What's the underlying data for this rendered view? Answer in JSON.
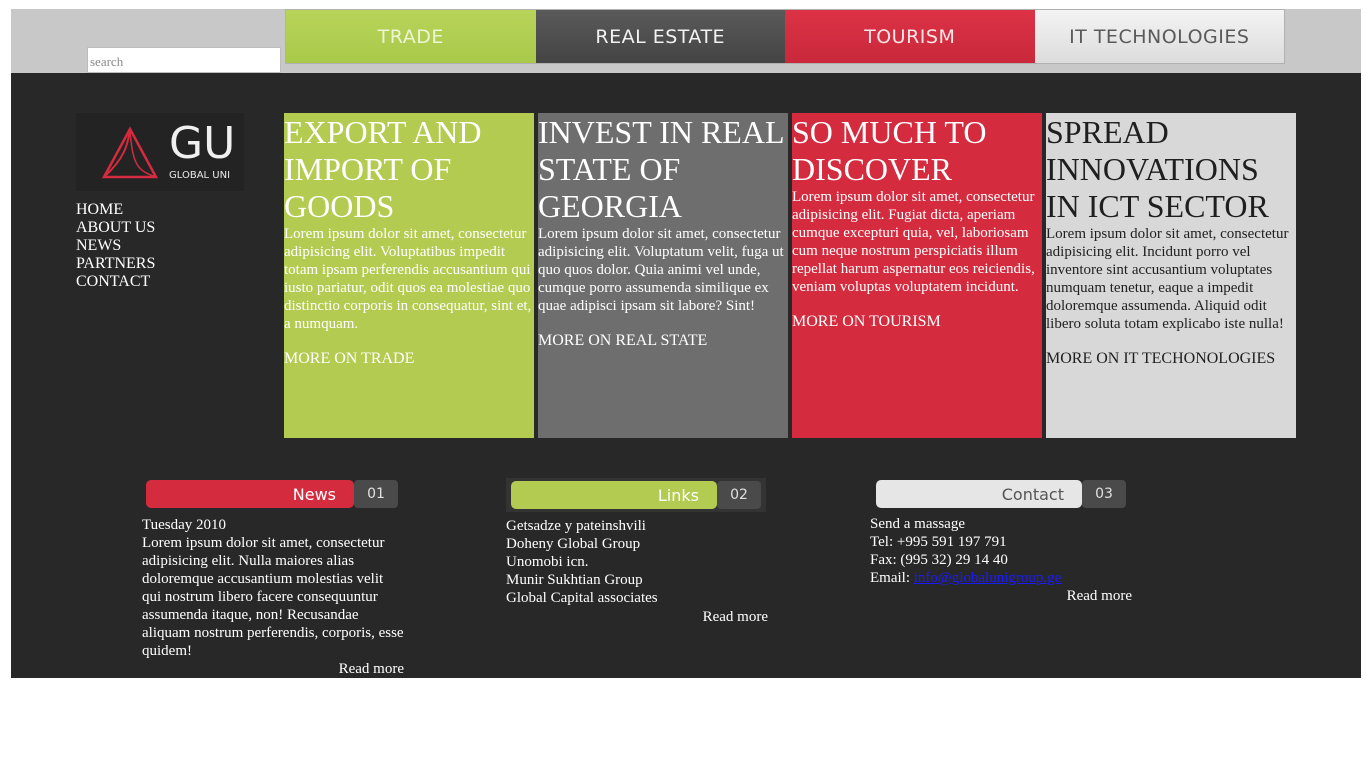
{
  "header": {
    "search_placeholder": "search",
    "tabs": [
      {
        "label": "TRADE",
        "color": "#b2cb50"
      },
      {
        "label": "REAL ESTATE",
        "color": "#4f4f4f"
      },
      {
        "label": "TOURISM",
        "color": "#d42b3e"
      },
      {
        "label": "IT TECHNOLOGIES",
        "color": "#e6e6e6"
      }
    ]
  },
  "logo": {
    "mark": "GU",
    "caption": "GLOBAL UNI",
    "icon": "triangle-logo-icon"
  },
  "nav": [
    "HOME",
    "ABOUT US",
    "NEWS",
    "PARTNERS",
    "CONTACT"
  ],
  "panels": [
    {
      "title": "EXPORT AND IMPORT OF GOODS",
      "body": "Lorem ipsum dolor sit amet, consectetur adipisicing elit. Voluptatibus impedit totam ipsam perferendis accusantium qui iusto pariatur, odit quos ea molestiae quo distinctio corporis in consequatur, sint et, a numquam.",
      "more": "MORE ON TRADE",
      "color": "#b2cb50"
    },
    {
      "title": "INVEST IN REAL STATE OF GEORGIA",
      "body": "Lorem ipsum dolor sit amet, consectetur adipisicing elit. Voluptatum velit, fuga ut quo quos dolor. Quia animi vel unde, cumque porro assumenda similique ex quae adipisci ipsam sit labore? Sint!",
      "more": "MORE ON REAL STATE",
      "color": "#6e6e6e"
    },
    {
      "title": "SO MUCH TO DISCOVER",
      "body": "Lorem ipsum dolor sit amet, consectetur adipisicing elit. Fugiat dicta, aperiam cumque excepturi quia, vel, laboriosam cum neque nostrum perspiciatis illum repellat harum aspernatur eos reiciendis, veniam voluptas voluptatem incidunt.",
      "more": "MORE ON TOURISM",
      "color": "#d42b3e"
    },
    {
      "title": "SPREAD INNOVATIONS IN ICT SECTOR",
      "body": "Lorem ipsum dolor sit amet, consectetur adipisicing elit. Incidunt porro vel inventore sint accusantium voluptates numquam tenetur, eaque a impedit doloremque assumenda. Aliquid odit libero soluta totam explicabo iste nulla!",
      "more": "MORE ON IT TECHONOLOGIES",
      "color": "#d8d8d8"
    }
  ],
  "news": {
    "badge": "News",
    "num": "01",
    "date": "Tuesday 2010",
    "text": "Lorem ipsum dolor sit amet, consectetur adipisicing elit. Nulla maiores alias doloremque accusantium molestias velit qui nostrum libero facere consequuntur assumenda itaque, non! Recusandae aliquam nostrum perferendis, corporis, esse quidem!",
    "read_more": "Read more"
  },
  "links": {
    "badge": "Links",
    "num": "02",
    "items": [
      "Getsadze y pateinshvili",
      "Doheny Global Group",
      "Unomobi icn.",
      "Munir Sukhtian Group",
      "Global Capital associates"
    ],
    "read_more": "Read more"
  },
  "contact": {
    "badge": "Contact",
    "num": "03",
    "heading": "Send a massage",
    "tel": "Tel: +995 591 197 791",
    "fax": "Fax: (995 32) 29 14 40",
    "email_label": "Email:",
    "email": "info@globalunigroup.ge",
    "read_more": "Read more"
  }
}
